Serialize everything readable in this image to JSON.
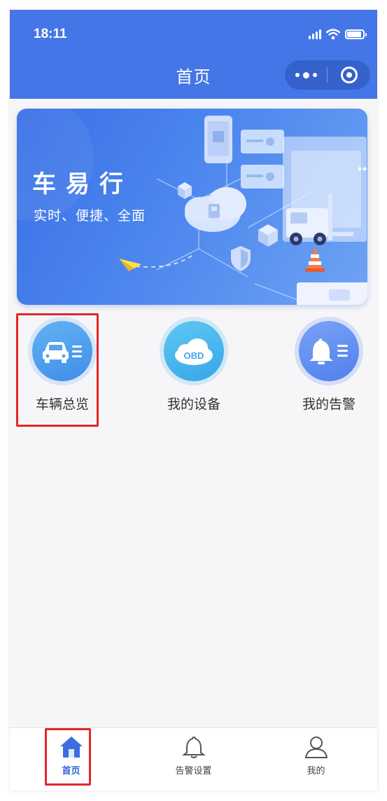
{
  "status_bar": {
    "time": "18:11"
  },
  "nav": {
    "title": "首页"
  },
  "banner": {
    "title": "车易行",
    "subtitle": "实时、便捷、全面"
  },
  "features": [
    {
      "label": "车辆总览",
      "icon": "car-list-icon",
      "color": "#4a98ec"
    },
    {
      "label": "我的设备",
      "icon": "obd-cloud-icon",
      "badge_text": "OBD",
      "color": "#40aeec"
    },
    {
      "label": "我的告警",
      "icon": "bell-list-icon",
      "color": "#5a89f0"
    }
  ],
  "tabbar": {
    "items": [
      {
        "label": "首页",
        "icon": "home-icon",
        "active": true
      },
      {
        "label": "告警设置",
        "icon": "bell-icon",
        "active": false
      },
      {
        "label": "我的",
        "icon": "user-icon",
        "active": false
      }
    ]
  },
  "colors": {
    "primary": "#4576e8",
    "highlight": "#e5262a",
    "tab_active": "#2f64d9"
  }
}
